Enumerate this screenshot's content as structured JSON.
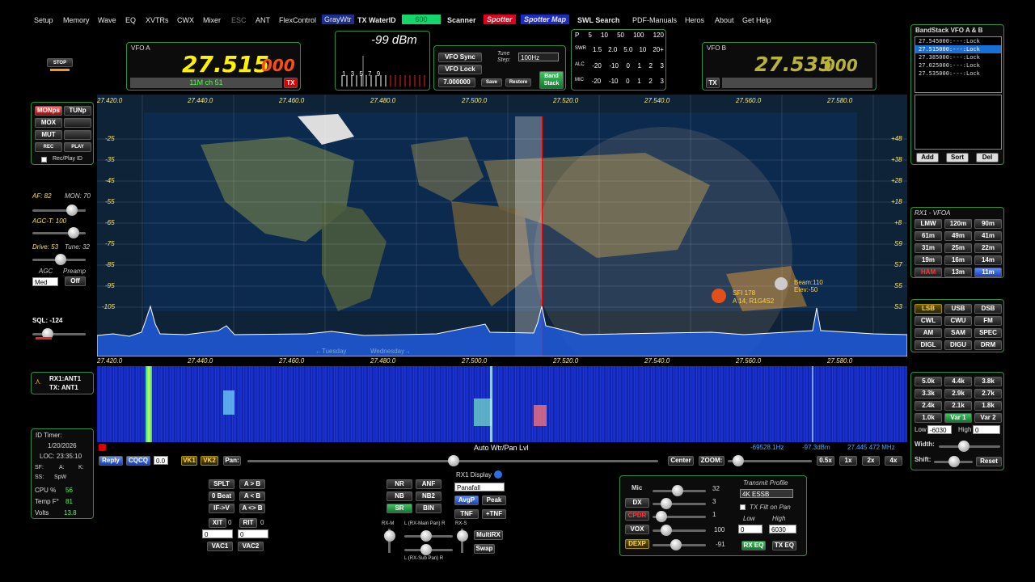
{
  "menu": [
    "Setup",
    "Memory",
    "Wave",
    "EQ",
    "XVTRs",
    "CWX",
    "Mixer",
    "ESC",
    "ANT",
    "FlexControl",
    "GrayWtr",
    "TX WaterID",
    "600",
    "Scanner",
    "Spotter",
    "Spotter Map",
    "SWL Search",
    "PDF-Manuals",
    "Heros",
    "About",
    "Get Help"
  ],
  "stop_label": "STOP",
  "vfoA": {
    "title": "VFO A",
    "freq_main": "27.515",
    "freq_sub": "000",
    "band": "11M ch 51",
    "tx": "TX"
  },
  "vfoB": {
    "title": "VFO B",
    "freq_main": "27.535",
    "freq_sub": "000",
    "tx": "TX"
  },
  "smeter": {
    "reading": "-99 dBm",
    "scale": "1 3 5 7 9"
  },
  "vfo_controls": {
    "sync": "VFO Sync",
    "lock": "VFO Lock",
    "tune_step_label": "Tune Step:",
    "tune_step": "100Hz",
    "freq": "7.000000",
    "save": "Save",
    "restore": "Restore",
    "bandstack": "Band Stack"
  },
  "meters": {
    "p_row": [
      "P",
      "5",
      "10",
      "50",
      "100",
      "120"
    ],
    "swr_row": [
      "SWR",
      "1.5",
      "2.0",
      "5.0",
      "10",
      "20+"
    ],
    "alc_row": [
      "ALC",
      "-20",
      "-10",
      "0",
      "1",
      "2",
      "3"
    ],
    "mic_row": [
      "MIC",
      "-20",
      "-10",
      "0",
      "1",
      "2",
      "3"
    ]
  },
  "bandstack_panel": {
    "title": "BandStack VFO A & B",
    "rows": [
      "27.545000:---:Lock",
      "27.515000:---:Lock",
      "27.385000:---:Lock",
      "27.025000:---:Lock",
      "27.535000:---:Lock"
    ],
    "selected": 1,
    "add": "Add",
    "sort": "Sort",
    "del": "Del"
  },
  "left_buttons": {
    "mon": "MONps",
    "tun": "TUNp",
    "mox": "MOX",
    "mut": "MUT",
    "rec": "REC",
    "play": "PLAY",
    "recplay_id": "Rec/Play ID"
  },
  "left_controls": {
    "af": "AF: 82",
    "mon": "MON: 70",
    "agct": "AGC-T: 100",
    "drive": "Drive: 53",
    "tune": "Tune: 32",
    "agc": "AGC",
    "preamp": "Preamp",
    "agc_val": "Med",
    "preamp_val": "Off",
    "sql": "SQL: -124"
  },
  "rx_ant": {
    "rx": "RX1:ANT1",
    "tx": "TX: ANT1"
  },
  "status": {
    "id_timer": "ID Timer:",
    "date": "1/20/2026",
    "loc": "LOC: 23:35:10",
    "sf": "SF:",
    "a": "A:",
    "k": "K:",
    "ss": "SS:",
    "spw": "SpW",
    "cpu_label": "CPU %",
    "cpu": "56",
    "temp_label": "Temp F°",
    "temp": "81",
    "volts_label": "Volts",
    "volts": "13.8"
  },
  "panadapter": {
    "freq_ticks": [
      "27.420.0",
      "27.440.0",
      "27.460.0",
      "27.480.0",
      "27.500.0",
      "27.520.0",
      "27.540.0",
      "27.560.0",
      "27.580.0"
    ],
    "db_left": [
      "-25",
      "-35",
      "-45",
      "-55",
      "-65",
      "-75",
      "-85",
      "-95",
      "-105"
    ],
    "db_right": [
      "+48",
      "+38",
      "+28",
      "+18",
      "+8",
      "S9",
      "S7",
      "S5",
      "S3"
    ],
    "spot1": "SFI 178",
    "spot2": "A 14, R1G4S2",
    "beam": "Beam:110",
    "elev": "Elev:-50",
    "day_left": "←Tuesday",
    "day_right": "Wednesday→"
  },
  "rx1_vfoa": {
    "title": "RX1 - VFOA",
    "bands": [
      "LMW",
      "120m",
      "90m",
      "61m",
      "49m",
      "41m",
      "31m",
      "25m",
      "22m",
      "19m",
      "16m",
      "14m",
      "HAM",
      "13m",
      "11m"
    ]
  },
  "modes": [
    "LSB",
    "USB",
    "DSB",
    "CWL",
    "CWU",
    "FM",
    "AM",
    "SAM",
    "SPEC",
    "DIGL",
    "DIGU",
    "DRM"
  ],
  "filters": {
    "buttons": [
      "5.0k",
      "4.4k",
      "3.8k",
      "3.3k",
      "2.9k",
      "2.7k",
      "2.4k",
      "2.1k",
      "1.8k",
      "1.0k",
      "Var 1",
      "Var 2"
    ],
    "low_label": "Low",
    "low": "-6030",
    "high_label": "High",
    "high": "0",
    "width": "Width:",
    "shift": "Shift:",
    "reset": "Reset"
  },
  "bottom_bar": {
    "reply": "Reply",
    "cqcq": "CQCQ",
    "val": "0.0",
    "vk1": "VK1",
    "vk2": "VK2",
    "pan": "Pan:",
    "auto": "Auto Wtr/Pan Lvl",
    "offset": "-69528.1Hz",
    "dbm": "-97.3dBm",
    "cursor": "27.445 472 MHz",
    "center": "Center",
    "zoom": "ZOOM:",
    "z05": "0.5x",
    "z1": "1x",
    "z2": "2x",
    "z4": "4x"
  },
  "split": {
    "splt": "SPLT",
    "ab": "A > B",
    "zerobeat": "0 Beat",
    "ba": "A < B",
    "ifv": "IF->V",
    "swap": "A <> B",
    "xit": "XIT",
    "xit_val": "0",
    "rit": "RIT",
    "rit_val": "0",
    "xit_box": "0",
    "rit_box": "0",
    "vac1": "VAC1",
    "vac2": "VAC2"
  },
  "dsp": {
    "nr": "NR",
    "anf": "ANF",
    "nb": "NB",
    "nb2": "NB2",
    "sr": "SR",
    "bin": "BIN",
    "rxm": "RX-M",
    "rxs": "RX-S",
    "main_pan": "L (RX-Main Pan) R",
    "sub_pan": "L (RX-Sub Pan) R",
    "multirx": "MultiRX",
    "swap": "Swap"
  },
  "display": {
    "title": "RX1 Display",
    "mode": "Panafall",
    "avgp": "AvgP",
    "peak": "Peak",
    "tnf": "TNF",
    "ptnf": "+TNF"
  },
  "tx_panel": {
    "mic": "Mic",
    "mic_val": "32",
    "dx": "DX",
    "dx_val": "3",
    "cpdr": "CPDR",
    "cpdr_val": "1",
    "vox": "VOX",
    "vox_val": "100",
    "dexp": "DEXP",
    "dexp_val": "-91",
    "profile_label": "Transmit Profile",
    "profile": "4K ESSB",
    "txfilt": "TX Filt on Pan",
    "low": "Low",
    "high": "High",
    "low_val": "0",
    "high_val": "6030",
    "rxeq": "RX EQ",
    "txeq": "TX EQ"
  }
}
